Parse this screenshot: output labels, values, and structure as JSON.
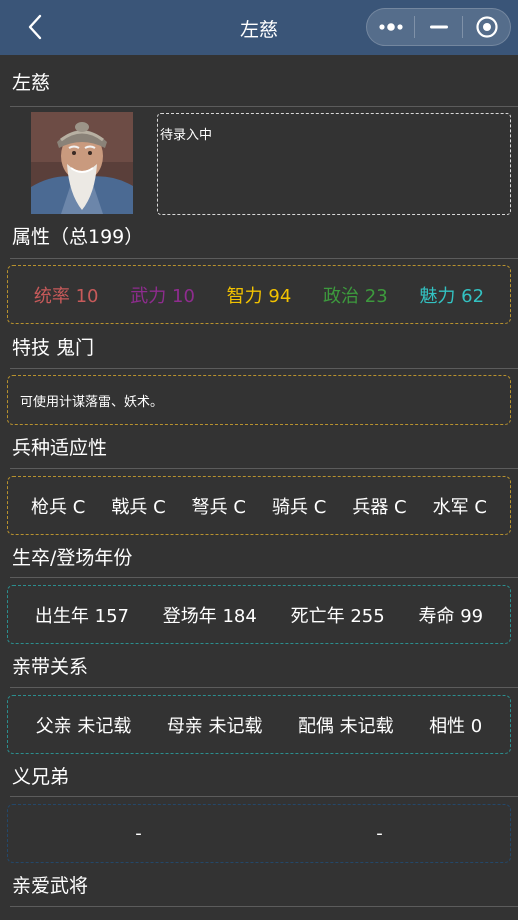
{
  "nav": {
    "title": "左慈"
  },
  "header": {
    "name": "左慈"
  },
  "bio": {
    "text": "待录入中"
  },
  "attributes": {
    "title": "属性（总199）",
    "stats": [
      {
        "label": "统率 10",
        "color": "#c75a5a"
      },
      {
        "label": "武力 10",
        "color": "#8e2c8e"
      },
      {
        "label": "智力 94",
        "color": "#f2c200"
      },
      {
        "label": "政治 23",
        "color": "#3d9a3d"
      },
      {
        "label": "魅力 62",
        "color": "#33c2c2"
      }
    ]
  },
  "skill": {
    "title": "特技 鬼门",
    "description": "可使用计谋落雷、妖术。"
  },
  "troops": {
    "title": "兵种适应性",
    "items": [
      "枪兵 C",
      "戟兵 C",
      "弩兵 C",
      "骑兵 C",
      "兵器 C",
      "水军 C"
    ]
  },
  "years": {
    "title": "生卒/登场年份",
    "items": [
      "出生年 157",
      "登场年 184",
      "死亡年 255",
      "寿命 99"
    ]
  },
  "relations": {
    "title": "亲带关系",
    "items": [
      "父亲 未记载",
      "母亲 未记载",
      "配偶 未记载",
      "相性 0"
    ]
  },
  "brothers": {
    "title": "义兄弟",
    "items": [
      "-",
      "-"
    ]
  },
  "favorites": {
    "title": "亲爱武将"
  }
}
